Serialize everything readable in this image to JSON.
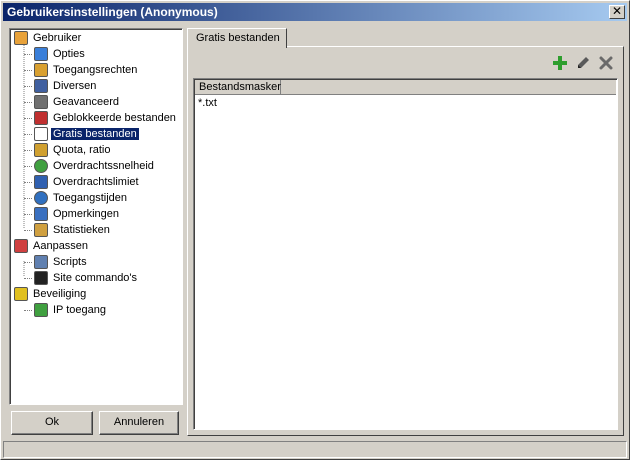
{
  "window": {
    "title": "Gebruikersinstellingen (Anonymous)",
    "close_label": "✕"
  },
  "tree": {
    "items": [
      {
        "label": "Gebruiker",
        "icon": "user-icon",
        "level": 0
      },
      {
        "label": "Opties",
        "icon": "options-icon",
        "level": 1
      },
      {
        "label": "Toegangsrechten",
        "icon": "access-rights-icon",
        "level": 1
      },
      {
        "label": "Diversen",
        "icon": "misc-icon",
        "level": 1
      },
      {
        "label": "Geavanceerd",
        "icon": "advanced-icon",
        "level": 1
      },
      {
        "label": "Geblokkeerde bestanden",
        "icon": "blocked-files-icon",
        "level": 1
      },
      {
        "label": "Gratis bestanden",
        "icon": "free-files-icon",
        "level": 1,
        "selected": true
      },
      {
        "label": "Quota, ratio",
        "icon": "quota-icon",
        "level": 1
      },
      {
        "label": "Overdrachtssnelheid",
        "icon": "speed-icon",
        "level": 1
      },
      {
        "label": "Overdrachtslimiet",
        "icon": "limit-icon",
        "level": 1
      },
      {
        "label": "Toegangstijden",
        "icon": "clock-icon",
        "level": 1
      },
      {
        "label": "Opmerkingen",
        "icon": "notes-icon",
        "level": 1
      },
      {
        "label": "Statistieken",
        "icon": "stats-icon",
        "level": 1
      },
      {
        "label": "Aanpassen",
        "icon": "customize-icon",
        "level": 0
      },
      {
        "label": "Scripts",
        "icon": "scripts-icon",
        "level": 1
      },
      {
        "label": "Site commando's",
        "icon": "console-icon",
        "level": 1
      },
      {
        "label": "Beveiliging",
        "icon": "security-icon",
        "level": 0
      },
      {
        "label": "IP toegang",
        "icon": "ip-access-icon",
        "level": 1
      }
    ]
  },
  "buttons": {
    "ok": "Ok",
    "cancel": "Annuleren"
  },
  "tab": {
    "label": "Gratis bestanden"
  },
  "toolbar": {
    "add_icon": "plus-icon",
    "edit_icon": "pencil-icon",
    "delete_icon": "delete-x-icon"
  },
  "list": {
    "columns": [
      "Bestandsmasker"
    ],
    "rows": [
      [
        "*.txt"
      ]
    ]
  },
  "colors": {
    "title_start": "#0a246a",
    "title_end": "#a6caf0",
    "selection": "#0a246a",
    "face": "#d4d0c8",
    "add_green": "#2e9e2e"
  }
}
